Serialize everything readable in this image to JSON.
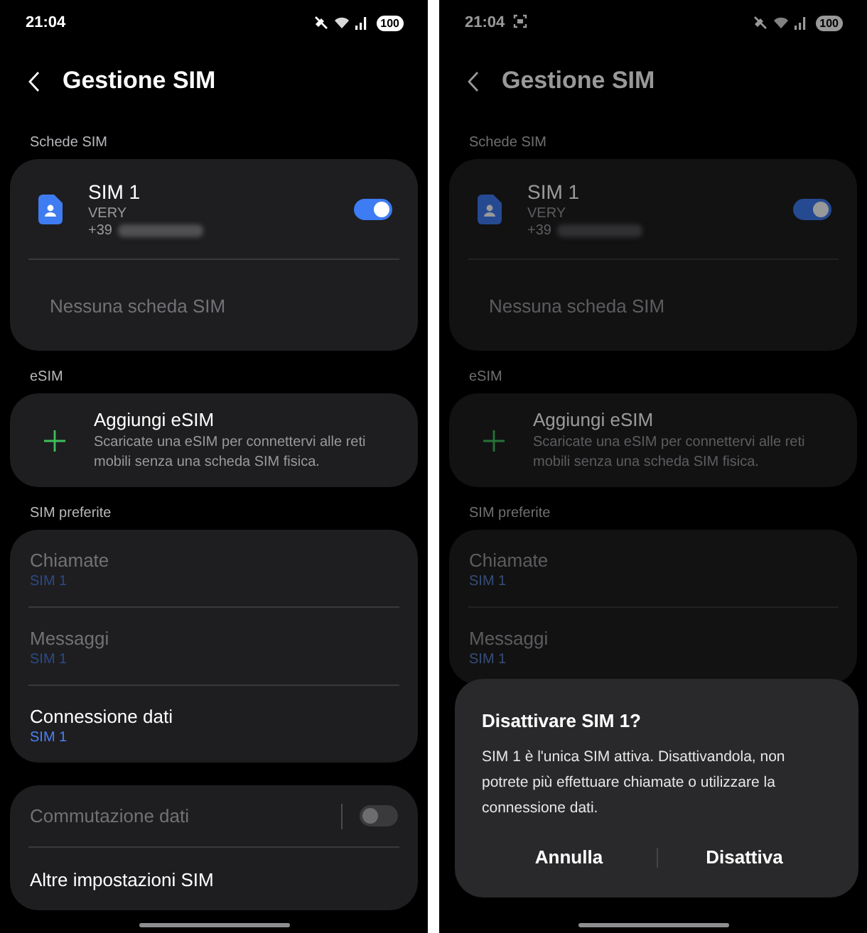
{
  "screens": [
    {
      "dimmed": false,
      "status_bar": {
        "time": "21:04",
        "screenshot_indicator": false,
        "battery": "100"
      },
      "header": {
        "title": "Gestione SIM"
      },
      "sections": [
        {
          "label": "Schede SIM",
          "items": [
            {
              "kind": "sim",
              "name": "SIM 1",
              "operator": "VERY",
              "number": "+39",
              "on": true
            },
            {
              "kind": "plain",
              "label": "Nessuna scheda SIM",
              "disabled": true
            }
          ]
        },
        {
          "label": "eSIM",
          "items": [
            {
              "kind": "action",
              "title": "Aggiungi eSIM",
              "description": "Scaricate una eSIM per connettervi alle reti mobili senza una scheda SIM fisica."
            }
          ]
        },
        {
          "label": "SIM preferite",
          "items": [
            {
              "kind": "pref",
              "label": "Chiamate",
              "value": "SIM 1",
              "disabled": true
            },
            {
              "kind": "pref",
              "label": "Messaggi",
              "value": "SIM 1",
              "disabled": true
            },
            {
              "kind": "pref",
              "label": "Connessione dati",
              "value": "SIM 1",
              "disabled": false
            }
          ]
        },
        {
          "items": [
            {
              "kind": "switch",
              "label": "Commutazione dati",
              "disabled": true,
              "on": false
            },
            {
              "kind": "plain",
              "label": "Altre impostazioni SIM",
              "disabled": false
            }
          ]
        }
      ]
    },
    {
      "dimmed": true,
      "status_bar": {
        "time": "21:04",
        "screenshot_indicator": true,
        "battery": "100"
      },
      "header": {
        "title": "Gestione SIM"
      },
      "sections": [
        {
          "label": "Schede SIM",
          "items": [
            {
              "kind": "sim",
              "name": "SIM 1",
              "operator": "VERY",
              "number": "+39",
              "on": true
            },
            {
              "kind": "plain",
              "label": "Nessuna scheda SIM",
              "disabled": true
            }
          ]
        },
        {
          "label": "eSIM",
          "items": [
            {
              "kind": "action",
              "title": "Aggiungi eSIM",
              "description": "Scaricate una eSIM per connettervi alle reti mobili senza una scheda SIM fisica."
            }
          ]
        },
        {
          "label": "SIM preferite",
          "items": [
            {
              "kind": "pref",
              "label": "Chiamate",
              "value": "SIM 1",
              "disabled": true
            },
            {
              "kind": "pref",
              "label": "Messaggi",
              "value": "SIM 1",
              "disabled": true
            }
          ]
        }
      ],
      "dialog": {
        "title": "Disattivare SIM 1?",
        "message": "SIM 1 è l'unica SIM attiva. Disattivandola, non potrete più effettuare chiamate o utilizzare la connessione dati.",
        "buttons": [
          "Annulla",
          "Disattiva"
        ]
      }
    }
  ]
}
